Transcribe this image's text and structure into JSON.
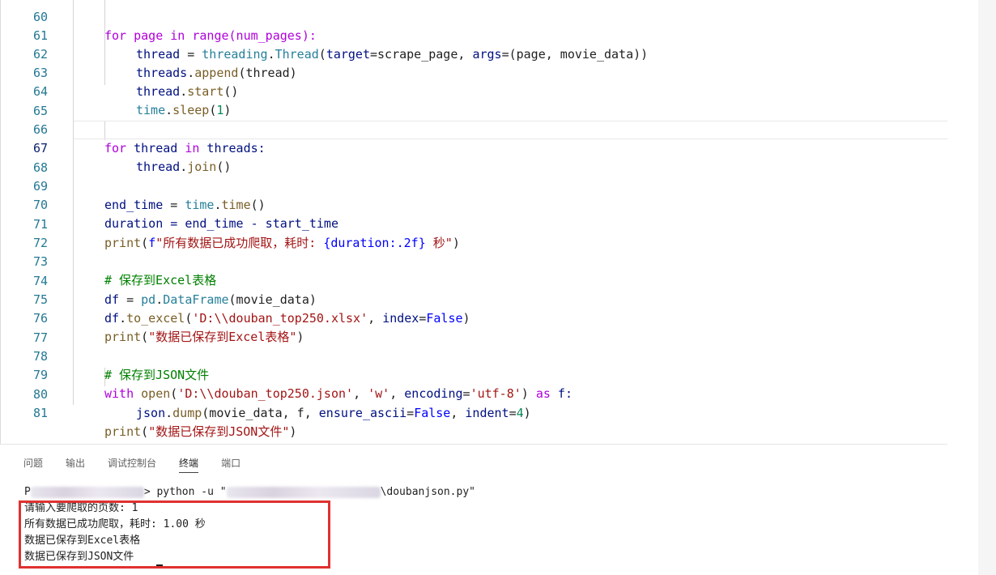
{
  "editor": {
    "partial_top_text": "for page in range(num_pages):",
    "lines": [
      {
        "num": "61"
      },
      {
        "num": "62"
      },
      {
        "num": "63"
      },
      {
        "num": "64"
      },
      {
        "num": "65"
      },
      {
        "num": "66"
      },
      {
        "num": "67"
      },
      {
        "num": "68"
      },
      {
        "num": "69"
      },
      {
        "num": "70"
      },
      {
        "num": "71"
      },
      {
        "num": "72"
      },
      {
        "num": "73"
      },
      {
        "num": "74"
      },
      {
        "num": "75"
      },
      {
        "num": "76"
      },
      {
        "num": "77"
      },
      {
        "num": "78"
      },
      {
        "num": "79"
      },
      {
        "num": "80"
      },
      {
        "num": "81"
      }
    ],
    "code": {
      "l61_a": "thread",
      "l61_b": " = ",
      "l61_c": "threading",
      "l61_d": ".",
      "l61_e": "Thread",
      "l61_f": "(",
      "l61_g": "target",
      "l61_h": "=scrape_page, ",
      "l61_i": "args",
      "l61_j": "=(page, movie_data))",
      "l62_a": "threads",
      "l62_b": ".",
      "l62_c": "append",
      "l62_d": "(thread)",
      "l63_a": "thread",
      "l63_b": ".",
      "l63_c": "start",
      "l63_d": "()",
      "l64_a": "time",
      "l64_b": ".",
      "l64_c": "sleep",
      "l64_d": "(",
      "l64_e": "1",
      "l64_f": ")",
      "l66_a": "for",
      "l66_b": " thread ",
      "l66_c": "in",
      "l66_d": " threads:",
      "l67_a": "thread",
      "l67_b": ".",
      "l67_c": "join",
      "l67_d": "()",
      "l69_a": "end_time",
      "l69_b": " = ",
      "l69_c": "time",
      "l69_d": ".",
      "l69_e": "time",
      "l69_f": "()",
      "l70_a": "duration",
      "l70_b": " = end_time - start_time",
      "l71_a": "print",
      "l71_b": "(",
      "l71_c": "f",
      "l71_d": "\"所有数据已成功爬取，耗时: ",
      "l71_e": "{duration:.2f}",
      "l71_f": " 秒\"",
      "l71_g": ")",
      "l73_a": "# 保存到Excel表格",
      "l74_a": "df",
      "l74_b": " = ",
      "l74_c": "pd",
      "l74_d": ".",
      "l74_e": "DataFrame",
      "l74_f": "(movie_data)",
      "l75_a": "df",
      "l75_b": ".",
      "l75_c": "to_excel",
      "l75_d": "(",
      "l75_e": "'D:\\\\douban_top250.xlsx'",
      "l75_f": ", ",
      "l75_g": "index",
      "l75_h": "=",
      "l75_i": "False",
      "l75_j": ")",
      "l76_a": "print",
      "l76_b": "(",
      "l76_c": "\"数据已保存到Excel表格\"",
      "l76_d": ")",
      "l78_a": "# 保存到JSON文件",
      "l79_a": "with",
      "l79_b": " ",
      "l79_c": "open",
      "l79_d": "(",
      "l79_e": "'D:\\\\douban_top250.json'",
      "l79_f": ", ",
      "l79_g": "'w'",
      "l79_h": ", ",
      "l79_i": "encoding",
      "l79_j": "=",
      "l79_k": "'utf-8'",
      "l79_l": ") ",
      "l79_m": "as",
      "l79_n": " f:",
      "l80_a": "json",
      "l80_b": ".",
      "l80_c": "dump",
      "l80_d": "(movie_data, f, ",
      "l80_e": "ensure_ascii",
      "l80_f": "=",
      "l80_g": "False",
      "l80_h": ", ",
      "l80_i": "indent",
      "l80_j": "=",
      "l80_k": "4",
      "l80_l": ")",
      "l81_a": "print",
      "l81_b": "(",
      "l81_c": "\"数据已保存到JSON文件\"",
      "l81_d": ")"
    }
  },
  "panel": {
    "tabs": [
      "问题",
      "输出",
      "调试控制台",
      "终端",
      "端口"
    ],
    "active_tab": "终端",
    "terminal": {
      "prompt_prefix": "P",
      "command_part1": "> python -u \"",
      "command_part2": "\\doubanjson.py\"",
      "output_lines": [
        "请输入要爬取的页数: 1",
        "所有数据已成功爬取，耗时: 1.00 秒",
        "数据已保存到Excel表格",
        "数据已保存到JSON文件"
      ]
    }
  },
  "colors": {
    "highlight_box": "#e03131",
    "line_number": "#237893",
    "keyword": "#0000ff",
    "control_keyword": "#af00db",
    "function": "#795e26",
    "string": "#a31515",
    "comment": "#008000"
  }
}
